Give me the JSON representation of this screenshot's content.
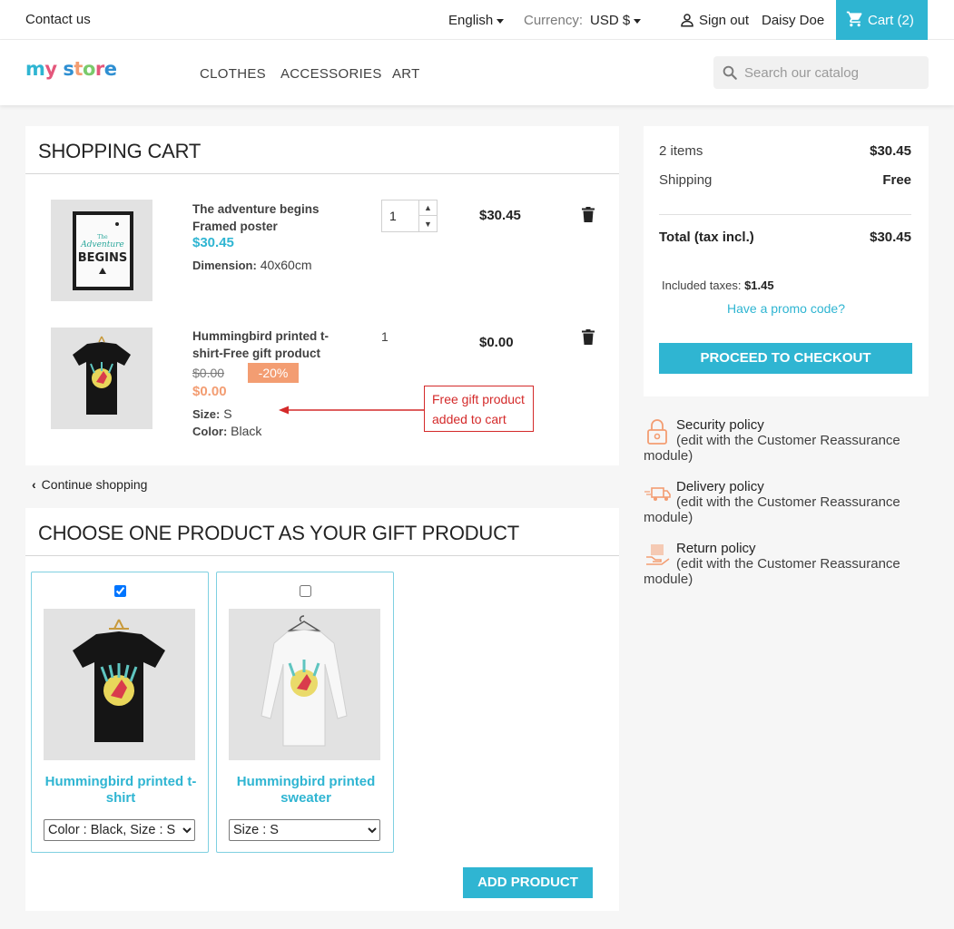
{
  "topbar": {
    "contact": "Contact us",
    "language": "English",
    "currency_label": "Currency:",
    "currency_value": "USD $",
    "signout": "Sign out",
    "username": "Daisy Doe",
    "cart": "Cart (2)"
  },
  "header": {
    "nav": [
      "CLOTHES",
      "ACCESSORIES",
      "ART"
    ],
    "search_placeholder": "Search our catalog"
  },
  "cart": {
    "title": "SHOPPING CART",
    "items": [
      {
        "name_line1": "The adventure begins",
        "name_line2": "Framed poster",
        "price": "$30.45",
        "attr_label": "Dimension:",
        "attr_value": "40x60cm",
        "qty": "1",
        "total": "$30.45"
      },
      {
        "name_line1": "Hummingbird printed t-",
        "name_line2": "shirt-Free gift product",
        "old_price": "$0.00",
        "discount": "-20%",
        "price": "$0.00",
        "size_label": "Size:",
        "size_value": "S",
        "color_label": "Color:",
        "color_value": "Black",
        "qty": "1",
        "total": "$0.00"
      }
    ],
    "annotation_line1": "Free gift product",
    "annotation_line2": "added to cart",
    "continue": "Continue shopping"
  },
  "gift": {
    "title": "CHOOSE ONE PRODUCT AS YOUR GIFT PRODUCT",
    "products": [
      {
        "name": "Hummingbird printed t-shirt",
        "option": "Color : Black, Size : S",
        "checked": true
      },
      {
        "name": "Hummingbird printed sweater",
        "option": "Size : S",
        "checked": false
      }
    ],
    "add_button": "ADD PRODUCT"
  },
  "summary": {
    "items_label": "2 items",
    "items_value": "$30.45",
    "shipping_label": "Shipping",
    "shipping_value": "Free",
    "total_label": "Total (tax incl.)",
    "total_value": "$30.45",
    "taxes_label": "Included taxes:",
    "taxes_value": "$1.45",
    "promo": "Have a promo code?",
    "checkout": "PROCEED TO CHECKOUT"
  },
  "reassurance": [
    {
      "title": "Security policy",
      "desc_a": "(edit with the Customer Reassurance",
      "desc_b": "module)",
      "icon": "lock-icon"
    },
    {
      "title": "Delivery policy",
      "desc_a": "(edit with the Customer Reassurance",
      "desc_b": "module)",
      "icon": "truck-icon"
    },
    {
      "title": "Return policy",
      "desc_a": "(edit with the Customer Reassurance",
      "desc_b": "module)",
      "icon": "return-box-icon"
    }
  ],
  "colors": {
    "accent": "#2fb5d2",
    "discount": "#f39d72",
    "annotation": "#d42a2a"
  }
}
